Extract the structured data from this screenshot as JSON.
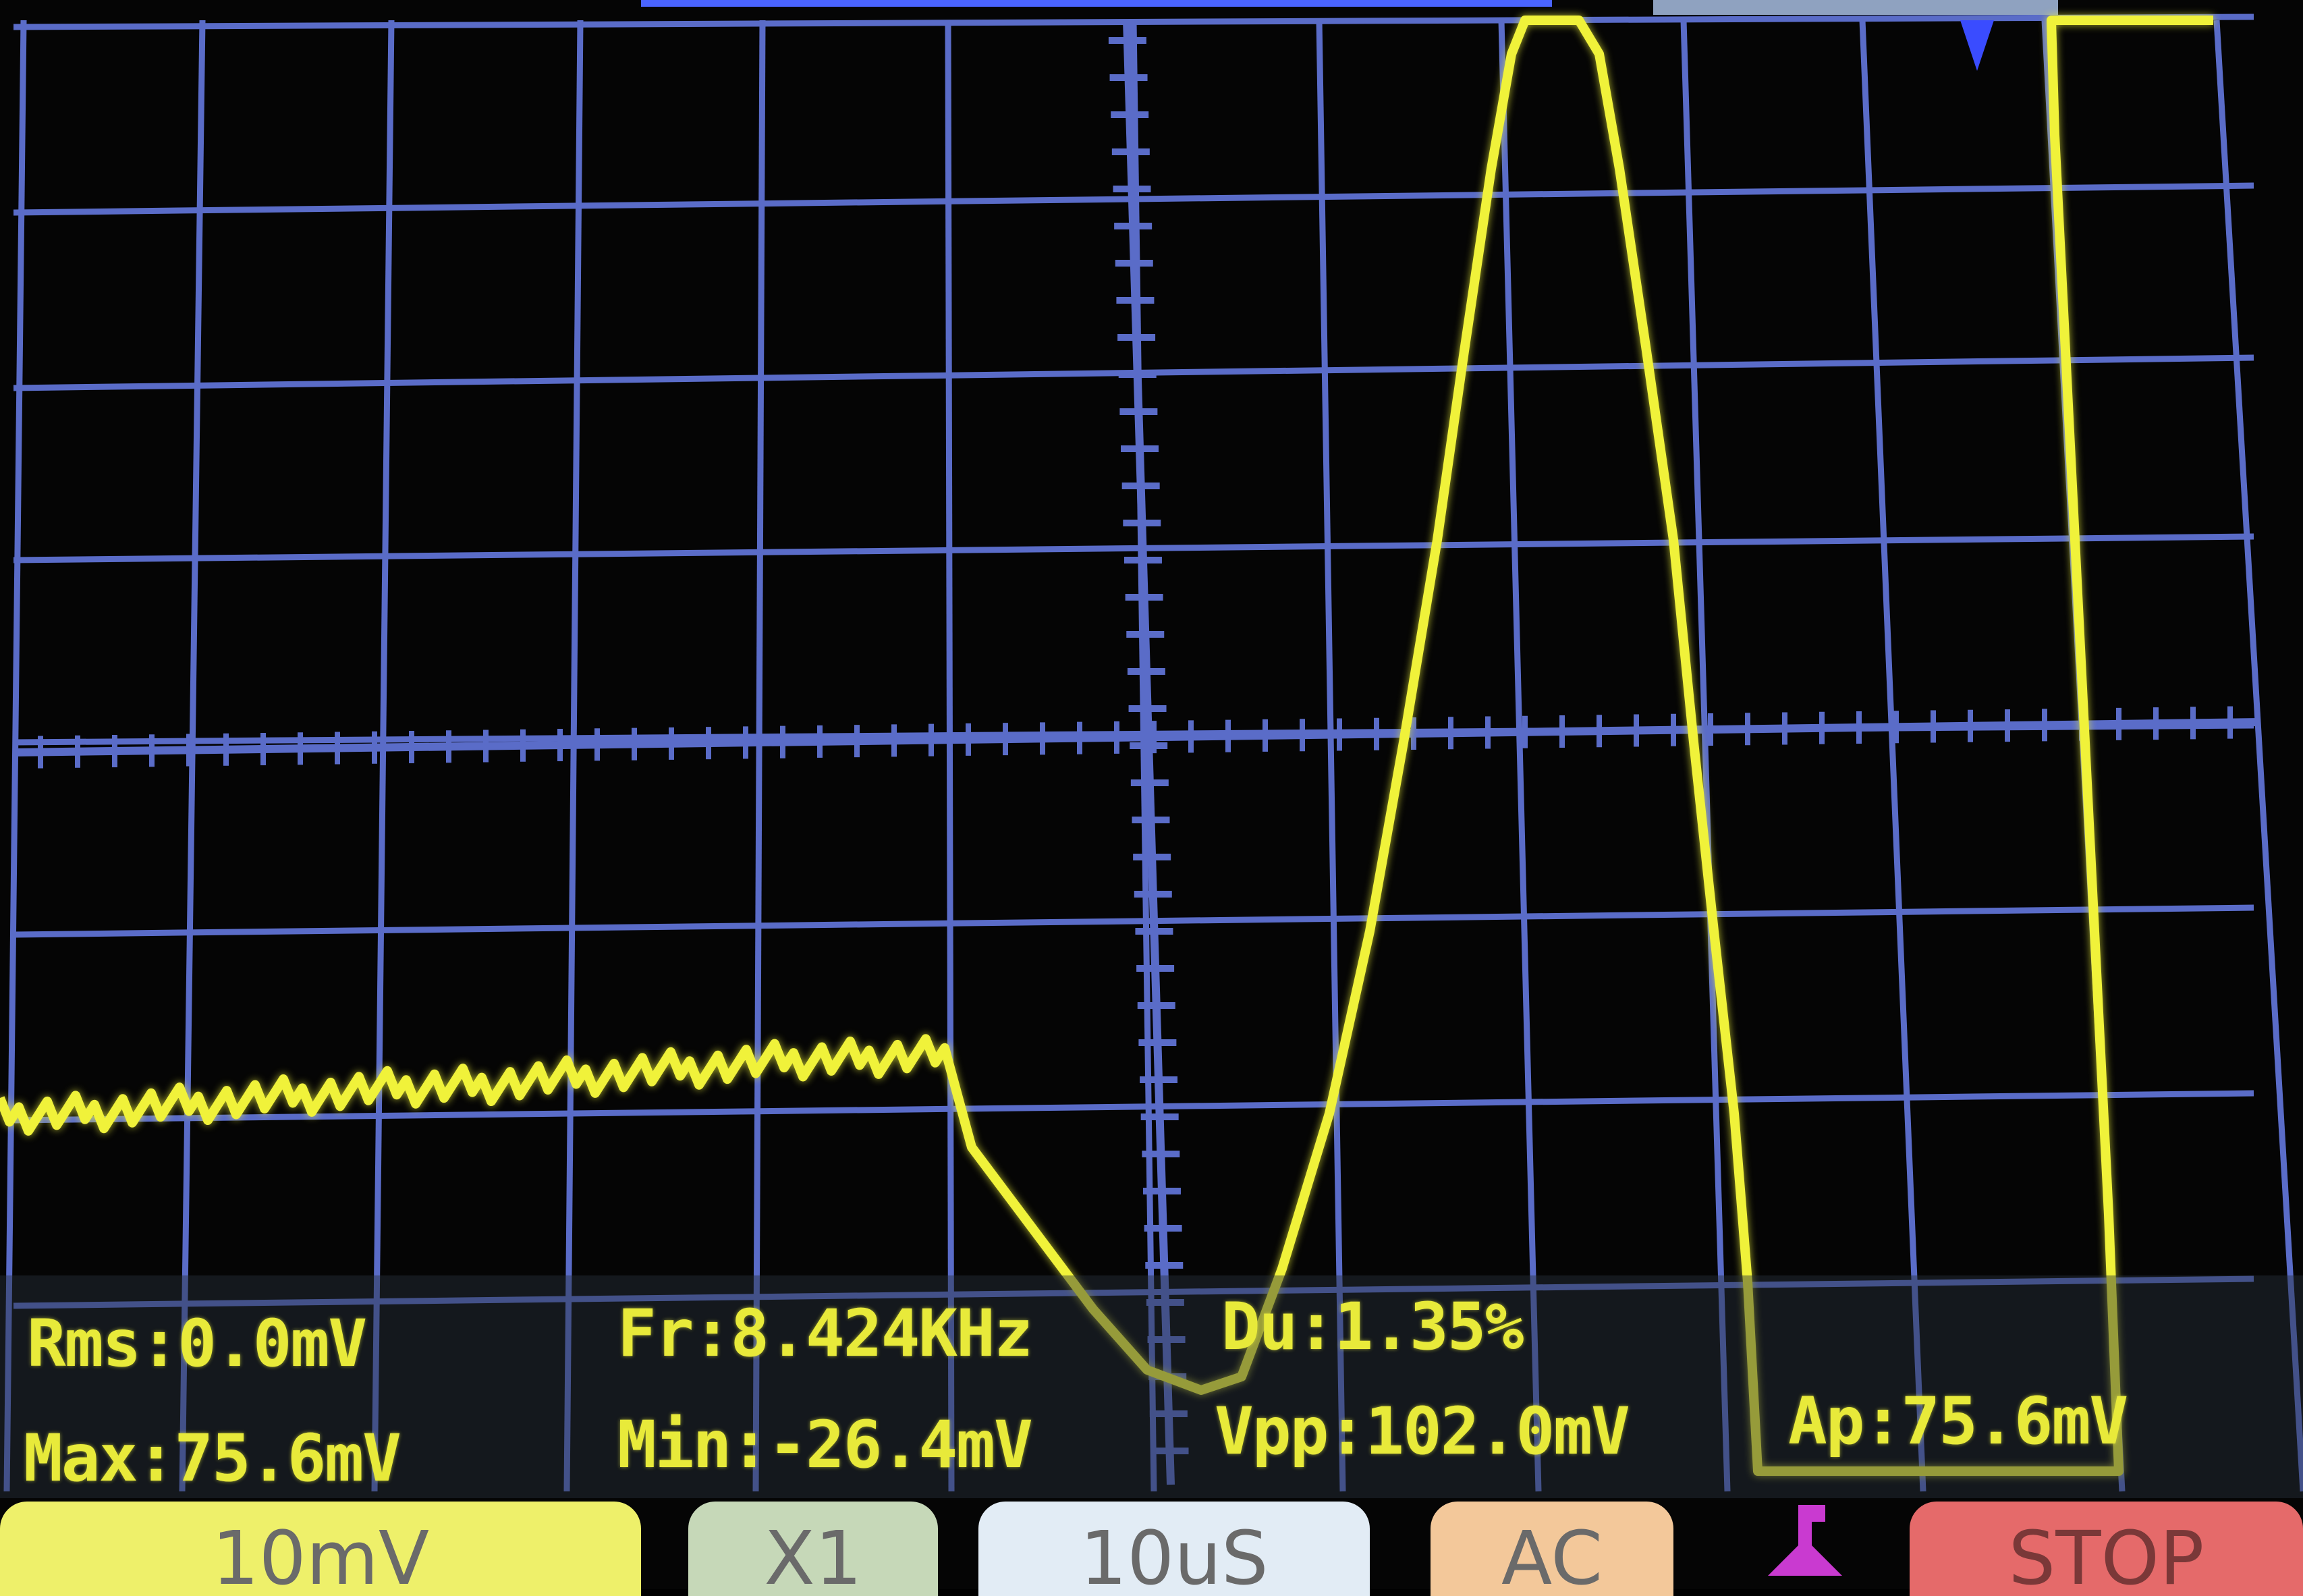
{
  "colors": {
    "grid": "#5a6cc8",
    "trace": "#f0f23a",
    "text": "#e8ea3a",
    "background": "#050505",
    "volt_button": "#eef06a",
    "probe_button": "#c6d8b8",
    "time_button": "#e2ecf5",
    "coupling_button": "#f3c89a",
    "run_button": "#e56a6a",
    "trigger_icon": "#c93ad0"
  },
  "measurements": {
    "rms": "Rms:0.0mV",
    "freq": "Fr:8.424KHz",
    "duty": "Du:1.35%",
    "max": "Max:75.6mV",
    "min": "Min:-26.4mV",
    "vpp": "Vpp:102.0mV",
    "ap": "Ap:75.6mV"
  },
  "controls": {
    "volt_div": "10mV",
    "probe": "X1",
    "time_div": "10uS",
    "coupling": "AC",
    "run_state": "STOP"
  },
  "icons": {
    "trigger_level": "trigger-edge-icon",
    "trigger_position": "trigger-marker-icon"
  }
}
